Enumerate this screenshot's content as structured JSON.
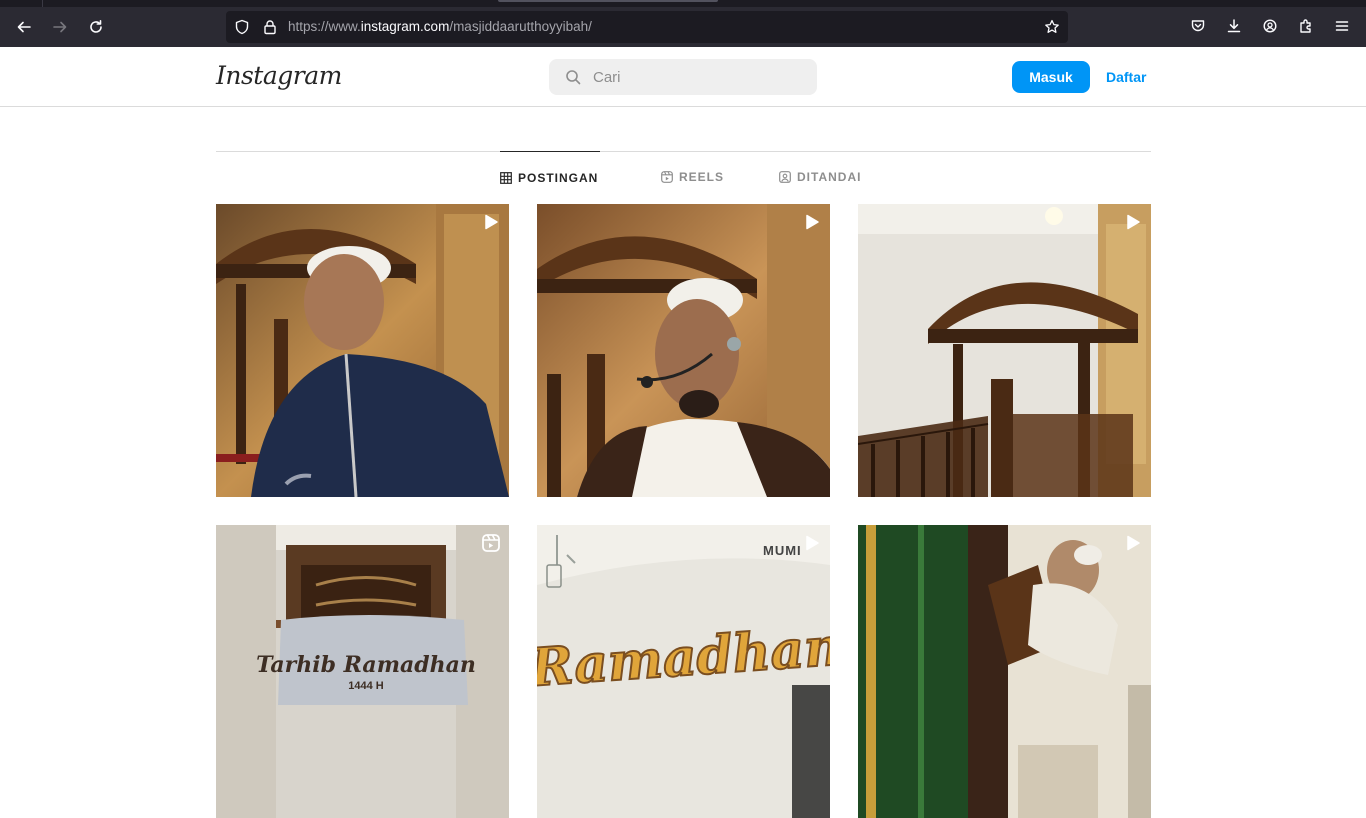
{
  "browser": {
    "url_prefix": "https://www.",
    "url_domain": "instagram.com",
    "url_path": "/masjiddaarutthoyyibah/"
  },
  "header": {
    "logo_text": "Instagram",
    "search_placeholder": "Cari",
    "login_label": "Masuk",
    "signup_label": "Daftar"
  },
  "tabs": [
    {
      "label": "POSTINGAN",
      "icon": "grid-icon",
      "active": true
    },
    {
      "label": "REELS",
      "icon": "reels-icon",
      "active": false
    },
    {
      "label": "DITANDAI",
      "icon": "tagged-icon",
      "active": false
    }
  ],
  "posts": [
    {
      "type": "video",
      "badge_icon": "play-icon"
    },
    {
      "type": "video",
      "badge_icon": "play-icon"
    },
    {
      "type": "video",
      "badge_icon": "play-icon"
    },
    {
      "type": "reel",
      "badge_icon": "reels-icon",
      "banner_title": "Tarhib Ramadhan",
      "banner_sub": "1444 H"
    },
    {
      "type": "video",
      "badge_icon": "play-icon",
      "banner_word": "Ramadhan",
      "top_text": "MUMI"
    },
    {
      "type": "video",
      "badge_icon": "play-icon"
    }
  ],
  "colors": {
    "accent": "#0095f6",
    "chrome_bg": "#2b2a33",
    "chrome_dark": "#1c1b22"
  }
}
